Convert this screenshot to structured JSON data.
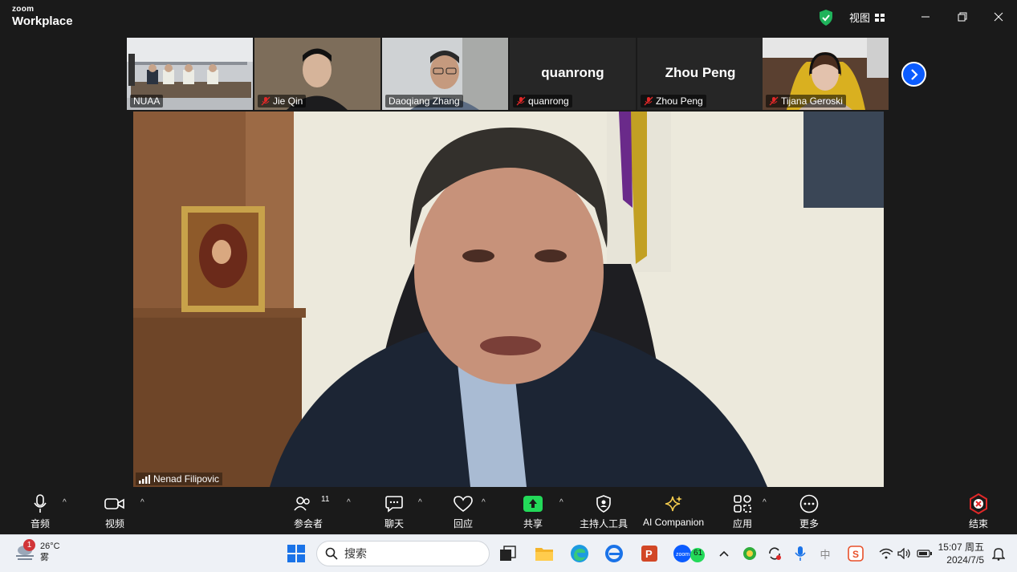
{
  "window": {
    "brand_top": "zoom",
    "brand_bottom": "Workplace",
    "view_label": "视图"
  },
  "thumbnails": [
    {
      "name": "NUAA",
      "muted": false
    },
    {
      "name": "Jie Qin",
      "muted": true
    },
    {
      "name": "Daoqiang Zhang",
      "muted": false
    },
    {
      "name": "quanrong",
      "muted": true,
      "display_name": "quanrong"
    },
    {
      "name": "Zhou Peng",
      "muted": true,
      "display_name": "Zhou Peng"
    },
    {
      "name": "Tijana Geroski",
      "muted": true
    }
  ],
  "speaker": {
    "name": "Nenad Filipovic"
  },
  "toolbar": {
    "audio": "音频",
    "video": "视频",
    "participants": "参会者",
    "participants_count": "11",
    "chat": "聊天",
    "reactions": "回应",
    "share": "共享",
    "host_tools": "主持人工具",
    "ai_companion": "AI Companion",
    "apps": "应用",
    "more": "更多",
    "end": "结束"
  },
  "taskbar": {
    "weather_temp": "26°C",
    "weather_desc": "雾",
    "weather_badge": "1",
    "search_placeholder": "搜索",
    "zoom_badge": "61",
    "ime": "中",
    "time": "15:07 周五",
    "date": "2024/7/5"
  },
  "colors": {
    "accent": "#0b5cff",
    "share_green": "#23d959",
    "mute_red": "#e02828",
    "shield_green": "#1fb35b",
    "end_red": "#e02828"
  }
}
